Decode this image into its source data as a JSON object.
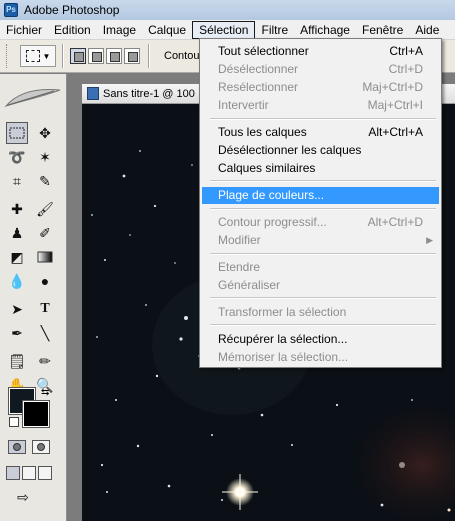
{
  "window": {
    "title": "Adobe Photoshop",
    "icon": "photoshop-icon"
  },
  "menubar": {
    "items": [
      "Fichier",
      "Edition",
      "Image",
      "Calque",
      "Sélection",
      "Filtre",
      "Affichage",
      "Fenêtre",
      "Aide"
    ],
    "active": "Sélection"
  },
  "options": {
    "contour_label": "Contour pr"
  },
  "document": {
    "title": "Sans titre-1 @ 100"
  },
  "selection_menu": {
    "items": [
      {
        "label": "Tout sélectionner",
        "shortcut": "Ctrl+A",
        "state": "enabled"
      },
      {
        "label": "Désélectionner",
        "shortcut": "Ctrl+D",
        "state": "disabled"
      },
      {
        "label": "Resélectionner",
        "shortcut": "Maj+Ctrl+D",
        "state": "disabled"
      },
      {
        "label": "Intervertir",
        "shortcut": "Maj+Ctrl+I",
        "state": "disabled"
      },
      {
        "label": "Tous les calques",
        "shortcut": "Alt+Ctrl+A",
        "state": "enabled"
      },
      {
        "label": "Désélectionner les calques",
        "shortcut": "",
        "state": "enabled"
      },
      {
        "label": "Calques similaires",
        "shortcut": "",
        "state": "enabled"
      },
      {
        "label": "Plage de couleurs...",
        "shortcut": "",
        "state": "highlighted"
      },
      {
        "label": "Contour progressif...",
        "shortcut": "Alt+Ctrl+D",
        "state": "disabled"
      },
      {
        "label": "Modifier",
        "shortcut": "",
        "state": "disabled",
        "submenu": true
      },
      {
        "label": "Etendre",
        "shortcut": "",
        "state": "disabled"
      },
      {
        "label": "Généraliser",
        "shortcut": "",
        "state": "disabled"
      },
      {
        "label": "Transformer la sélection",
        "shortcut": "",
        "state": "disabled"
      },
      {
        "label": "Récupérer la sélection...",
        "shortcut": "",
        "state": "enabled"
      },
      {
        "label": "Mémoriser la sélection...",
        "shortcut": "",
        "state": "disabled"
      }
    ]
  },
  "colors": {
    "highlight": "#3399ff",
    "disabled_text": "#8d8d8d",
    "foreground": "#101820",
    "background": "#000000"
  }
}
